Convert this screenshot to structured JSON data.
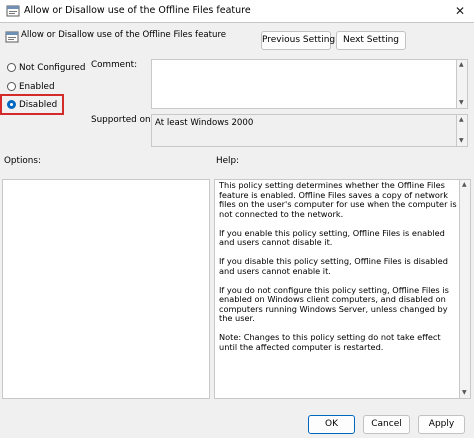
{
  "window": {
    "title": "Allow or Disallow use of the Offline Files feature",
    "close_glyph": "✕"
  },
  "header": {
    "setting_name": "Allow or Disallow use of the Offline Files feature",
    "previous_label": "Previous Setting",
    "next_label": "Next Setting"
  },
  "state": {
    "options": [
      {
        "label": "Not Configured",
        "selected": false
      },
      {
        "label": "Enabled",
        "selected": false
      },
      {
        "label": "Disabled",
        "selected": true
      }
    ],
    "highlight_color": "#d42a2a"
  },
  "comment": {
    "label": "Comment:",
    "value": ""
  },
  "supported": {
    "label": "Supported on:",
    "value": "At least Windows 2000"
  },
  "panes": {
    "options_label": "Options:",
    "help_label": "Help:"
  },
  "help": {
    "paragraphs": [
      "This policy setting determines whether the Offline Files feature is enabled. Offline Files saves a copy of network files on the user's computer for use when the computer is not connected to the network.",
      "If you enable this policy setting, Offline Files is enabled and users cannot disable it.",
      "If you disable this policy setting, Offline Files is disabled and users cannot enable it.",
      "If you do not configure this policy setting, Offline Files is enabled on Windows client computers, and disabled on computers running Windows Server, unless changed by the user.",
      "Note: Changes to this policy setting do not take effect until the affected computer is restarted."
    ]
  },
  "footer": {
    "ok_label": "OK",
    "cancel_label": "Cancel",
    "apply_label": "Apply"
  },
  "icons": {
    "policy": "policy-settings-icon",
    "accent": "#0067c0"
  }
}
